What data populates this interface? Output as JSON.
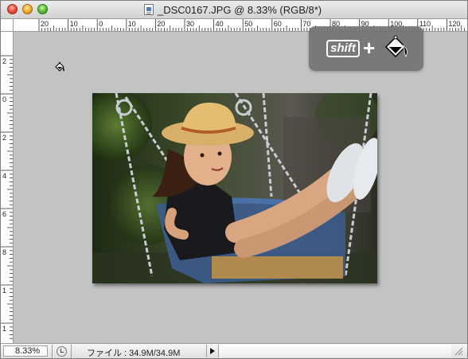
{
  "window": {
    "title": "_DSC0167.JPG @ 8.33% (RGB/8*)"
  },
  "ruler": {
    "horizontal_labels": [
      "20",
      "10",
      "0",
      "10",
      "20",
      "30",
      "40",
      "50",
      "60",
      "70",
      "80",
      "90",
      "100",
      "110",
      "120"
    ],
    "vertical_labels": [
      "2",
      "0",
      "2",
      "4",
      "6",
      "8",
      "1",
      "1"
    ]
  },
  "overlay": {
    "shift_key_label": "shift",
    "plus_label": "+"
  },
  "canvas": {
    "tool_cursor": "paint-bucket-icon",
    "photo": "girl-on-swing-photo"
  },
  "status": {
    "zoom": "8.33%",
    "file_info": "ファイル : 34.9M/34.9M"
  },
  "colors": {
    "canvas_bg": "#c3c3c3",
    "overlay_bg": "#6e6e6e"
  }
}
